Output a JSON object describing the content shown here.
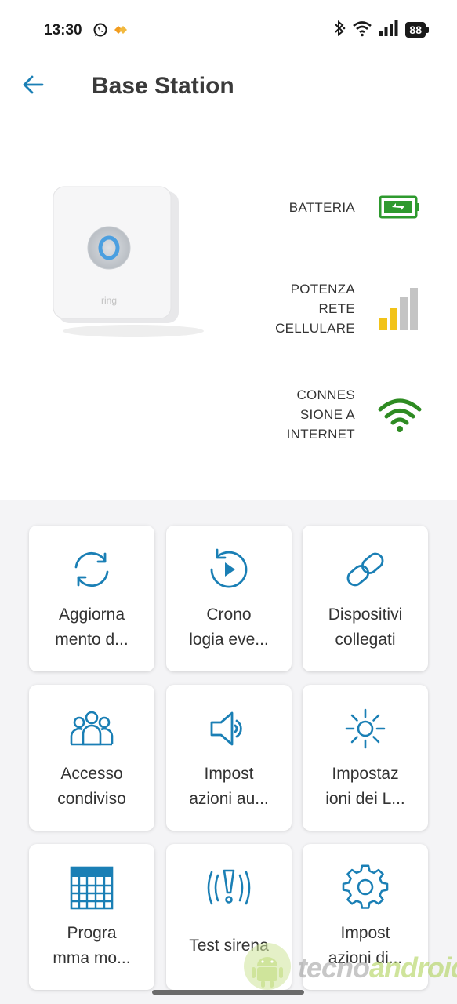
{
  "status_bar": {
    "time": "13:30",
    "battery": "88",
    "icons": [
      "whatsapp-icon",
      "notification-icon",
      "bluetooth-icon",
      "wifi-icon",
      "signal-icon",
      "battery-icon"
    ]
  },
  "header": {
    "title": "Base Station",
    "back_icon": "arrow-left-icon"
  },
  "device": {
    "logo_text": "ring"
  },
  "status": [
    {
      "label": "BATTERIA",
      "icon": "battery-charging-icon",
      "color": "#2e9a2e"
    },
    {
      "label": "POTENZA\nRETE\nCELLULARE",
      "icon": "cellular-signal-icon",
      "color": "#f2c318"
    },
    {
      "label": "CONNES\nSIONE A\nINTERNET",
      "icon": "wifi-icon",
      "color": "#2e8b22"
    }
  ],
  "tiles": [
    {
      "label": "Aggiorna\nmento d...",
      "icon": "refresh-icon"
    },
    {
      "label": "Crono\nlogia eve...",
      "icon": "history-icon"
    },
    {
      "label": "Dispositivi\ncollegati",
      "icon": "link-icon"
    },
    {
      "label": "Accesso\ncondiviso",
      "icon": "group-icon"
    },
    {
      "label": "Impost\nazioni au...",
      "icon": "speaker-icon"
    },
    {
      "label": "Impostaz\nioni dei L...",
      "icon": "sun-icon"
    },
    {
      "label": "Progra\nmma mo...",
      "icon": "calendar-icon"
    },
    {
      "label": "Test sirena",
      "icon": "siren-icon"
    },
    {
      "label": "Impost\nazioni di...",
      "icon": "gear-icon"
    }
  ],
  "watermark": {
    "part1": "tecno",
    "part2": "android"
  },
  "colors": {
    "accent": "#1a7fb5",
    "battery_green": "#2e9a2e",
    "signal_yellow": "#f2c318",
    "wifi_green": "#2e8b22",
    "grid_background": "#f4f4f6"
  }
}
